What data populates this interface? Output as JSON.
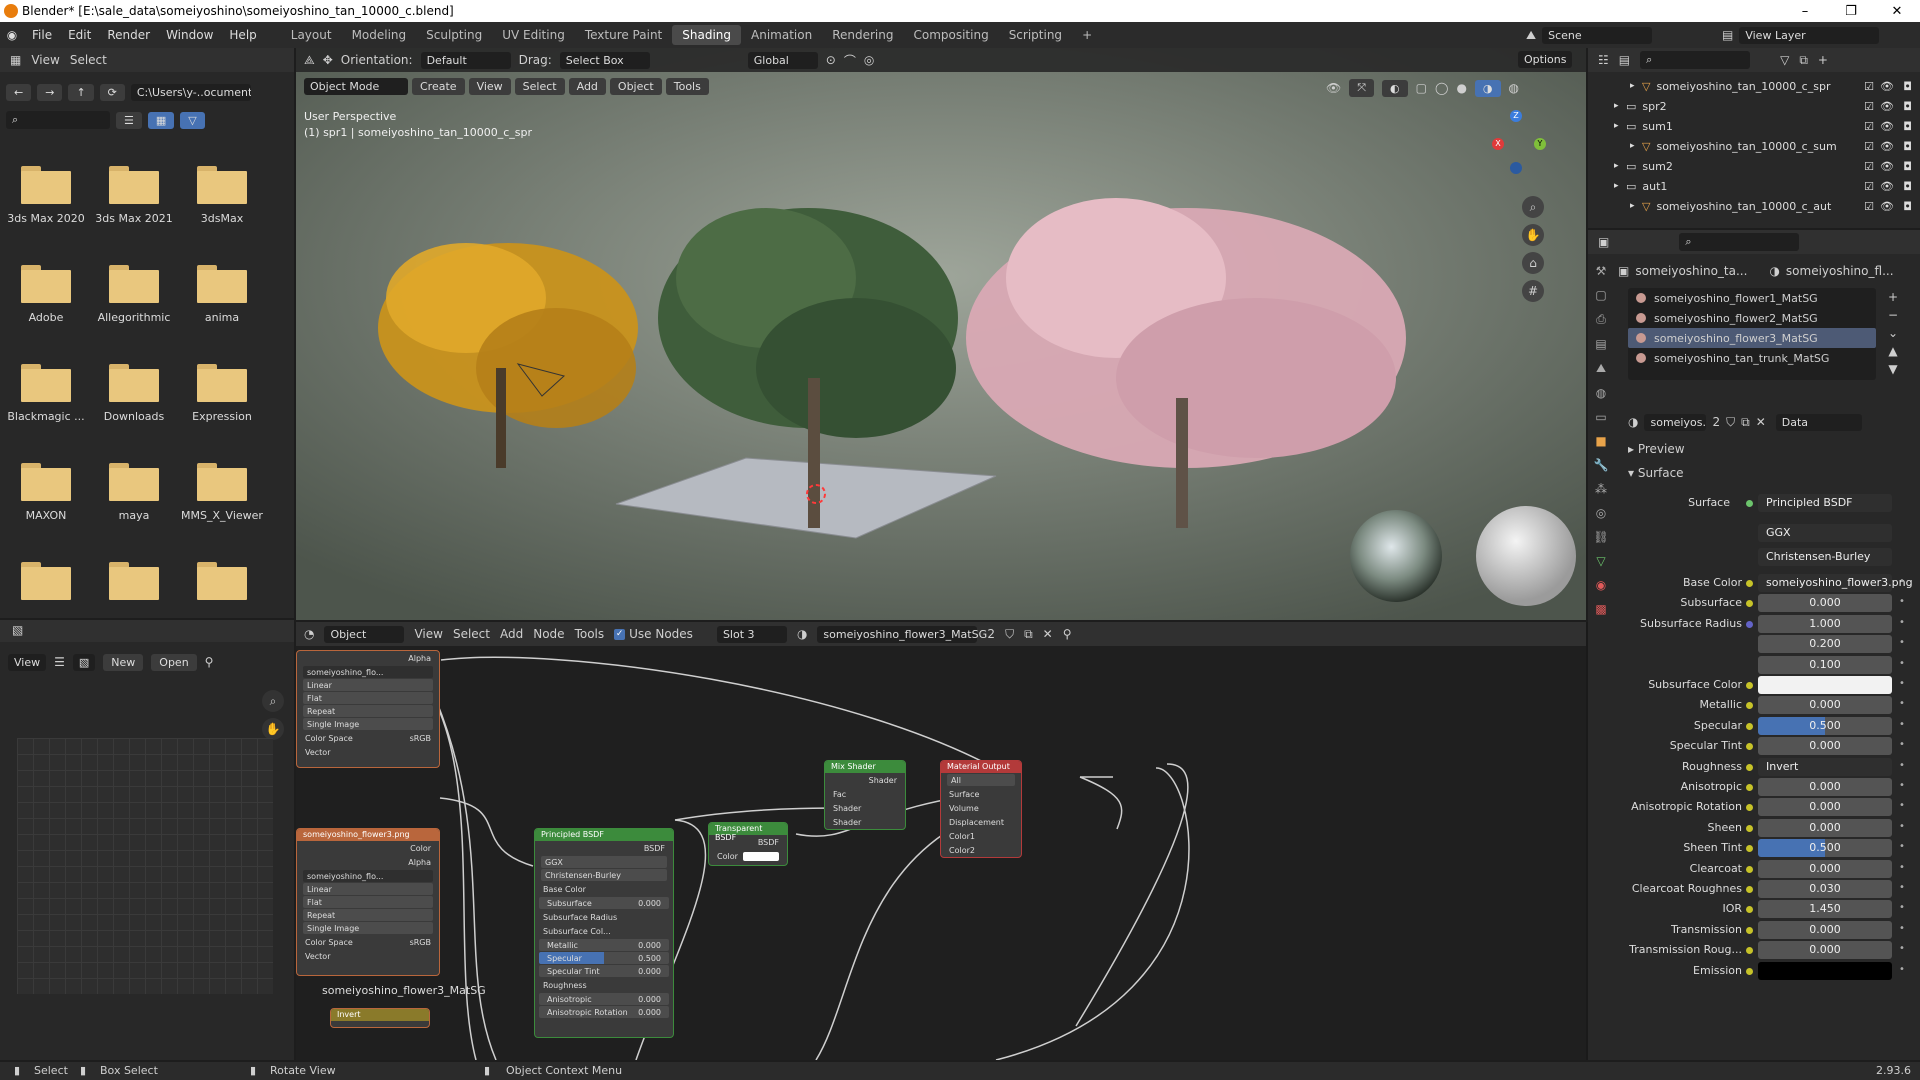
{
  "window": {
    "title": "Blender* [E:\\sale_data\\someiyoshino\\someiyoshino_tan_10000_c.blend]",
    "controls": [
      "–",
      "❐",
      "✕"
    ]
  },
  "menu": [
    "File",
    "Edit",
    "Render",
    "Window",
    "Help"
  ],
  "workspaces": [
    "Layout",
    "Modeling",
    "Sculpting",
    "UV Editing",
    "Texture Paint",
    "Shading",
    "Animation",
    "Rendering",
    "Compositing",
    "Scripting",
    "+"
  ],
  "active_workspace": "Shading",
  "scene": {
    "label": "Scene",
    "view_layer": "View Layer"
  },
  "file_browser": {
    "header": [
      "View",
      "Select"
    ],
    "path": "C:\\Users\\y-..ocuments\\",
    "folders": [
      "3ds Max 2020",
      "3ds Max 2021",
      "3dsMax",
      "Adobe",
      "Allegorithmic",
      "anima",
      "Blackmagic ...",
      "Downloads",
      "Expression",
      "MAXON",
      "maya",
      "MMS_X_Viewer",
      "",
      "",
      ""
    ]
  },
  "image_editor": {
    "view": "View",
    "new": "New",
    "open": "Open"
  },
  "viewport_header": {
    "orientation_label": "Orientation:",
    "orientation": "Default",
    "drag_label": "Drag:",
    "drag": "Select Box",
    "options": "Options",
    "mode": "Object Mode",
    "menus": [
      "Create",
      "View",
      "Select",
      "Add",
      "Object",
      "Tools"
    ],
    "transform": "Global"
  },
  "viewport": {
    "perspective": "User Perspective",
    "object_info": "(1) spr1 | someiyoshino_tan_10000_c_spr",
    "gizmo": {
      "x": "X",
      "y": "Y",
      "z": "Z"
    }
  },
  "node_header": {
    "object": "Object",
    "menus": [
      "View",
      "Select",
      "Add",
      "Node",
      "Tools"
    ],
    "use_nodes": "Use Nodes",
    "slot": "Slot 3",
    "material": "someiyoshino_flower3_MatSG",
    "users": "2"
  },
  "nodes": {
    "tex1": {
      "title": "someiyoshino_flo...",
      "alpha": "Alpha",
      "options": [
        "Linear",
        "Flat",
        "Repeat",
        "Single Image"
      ],
      "color_space_label": "Color Space",
      "color_space": "sRGB",
      "vector": "Vector"
    },
    "tex2": {
      "title": "someiyoshino_flower3.png",
      "color": "Color",
      "alpha": "Alpha",
      "img": "someiyoshino_flo...",
      "options": [
        "Linear",
        "Flat",
        "Repeat",
        "Single Image"
      ],
      "color_space_label": "Color Space",
      "color_space": "sRGB",
      "vector": "Vector"
    },
    "bsdf": {
      "title": "Principled BSDF",
      "out": "BSDF",
      "dist": "GGX",
      "sss": "Christensen-Burley",
      "rows": [
        [
          "Base Color",
          ""
        ],
        [
          "Subsurface",
          "0.000"
        ],
        [
          "Subsurface Radius",
          ""
        ],
        [
          "Subsurface Col...",
          ""
        ],
        [
          "Metallic",
          "0.000"
        ],
        [
          "Specular",
          "0.500"
        ],
        [
          "Specular Tint",
          "0.000"
        ],
        [
          "Roughness",
          ""
        ],
        [
          "Anisotropic",
          "0.000"
        ],
        [
          "Anisotropic Rotation",
          "0.000"
        ]
      ]
    },
    "transparent": {
      "title": "Transparent BSDF",
      "out": "BSDF",
      "color": "Color"
    },
    "mix": {
      "title": "Mix Shader",
      "out": "Shader",
      "fac": "Fac",
      "s1": "Shader",
      "s2": "Shader"
    },
    "output": {
      "title": "Material Output",
      "target": "All",
      "surface": "Surface",
      "volume": "Volume",
      "displacement": "Displacement",
      "color1": "Color1",
      "color2": "Color2"
    },
    "frame_label": "someiyoshino_flower3_MatSG",
    "invert": "Invert"
  },
  "outliner": [
    {
      "indent": 2,
      "name": "someiyoshino_tan_10000_c_spr",
      "type": "mesh"
    },
    {
      "indent": 1,
      "name": "spr2",
      "type": "collection"
    },
    {
      "indent": 1,
      "name": "sum1",
      "type": "collection"
    },
    {
      "indent": 2,
      "name": "someiyoshino_tan_10000_c_sum",
      "type": "mesh"
    },
    {
      "indent": 1,
      "name": "sum2",
      "type": "collection"
    },
    {
      "indent": 1,
      "name": "aut1",
      "type": "collection"
    },
    {
      "indent": 2,
      "name": "someiyoshino_tan_10000_c_aut",
      "type": "mesh"
    }
  ],
  "properties": {
    "breadcrumb": [
      "someiyoshino_ta...",
      "someiyoshino_fl..."
    ],
    "material_slots": [
      "someiyoshino_flower1_MatSG",
      "someiyoshino_flower2_MatSG",
      "someiyoshino_flower3_MatSG",
      "someiyoshino_tan_trunk_MatSG"
    ],
    "active_slot": 2,
    "mat_name": "someiyos...",
    "mat_users": "2",
    "link": "Data",
    "preview": "Preview",
    "surface_panel": "Surface",
    "surface_label": "Surface",
    "surface_value": "Principled BSDF",
    "distribution": "GGX",
    "subsurface_method": "Christensen-Burley",
    "rows": [
      {
        "label": "Base Color",
        "value": "someiyoshino_flower3.png",
        "kind": "link"
      },
      {
        "label": "Subsurface",
        "value": "0.000",
        "kind": "num"
      },
      {
        "label": "Subsurface Radius",
        "value": "1.000",
        "kind": "num"
      },
      {
        "label": "",
        "value": "0.200",
        "kind": "num"
      },
      {
        "label": "",
        "value": "0.100",
        "kind": "num"
      },
      {
        "label": "Subsurface Color",
        "value": "",
        "kind": "color"
      },
      {
        "label": "Metallic",
        "value": "0.000",
        "kind": "num"
      },
      {
        "label": "Specular",
        "value": "0.500",
        "kind": "slider"
      },
      {
        "label": "Specular Tint",
        "value": "0.000",
        "kind": "num"
      },
      {
        "label": "Roughness",
        "value": "Invert",
        "kind": "link"
      },
      {
        "label": "Anisotropic",
        "value": "0.000",
        "kind": "num"
      },
      {
        "label": "Anisotropic Rotation",
        "value": "0.000",
        "kind": "num"
      },
      {
        "label": "Sheen",
        "value": "0.000",
        "kind": "num"
      },
      {
        "label": "Sheen Tint",
        "value": "0.500",
        "kind": "slider"
      },
      {
        "label": "Clearcoat",
        "value": "0.000",
        "kind": "num"
      },
      {
        "label": "Clearcoat Roughnes",
        "value": "0.030",
        "kind": "num"
      },
      {
        "label": "IOR",
        "value": "1.450",
        "kind": "num"
      },
      {
        "label": "Transmission",
        "value": "0.000",
        "kind": "num"
      },
      {
        "label": "Transmission Roug...",
        "value": "0.000",
        "kind": "num"
      },
      {
        "label": "Emission",
        "value": "",
        "kind": "black"
      }
    ]
  },
  "status": {
    "select": "Select",
    "box_select": "Box Select",
    "rotate": "Rotate View",
    "context": "Object Context Menu",
    "version": "2.93.6"
  }
}
